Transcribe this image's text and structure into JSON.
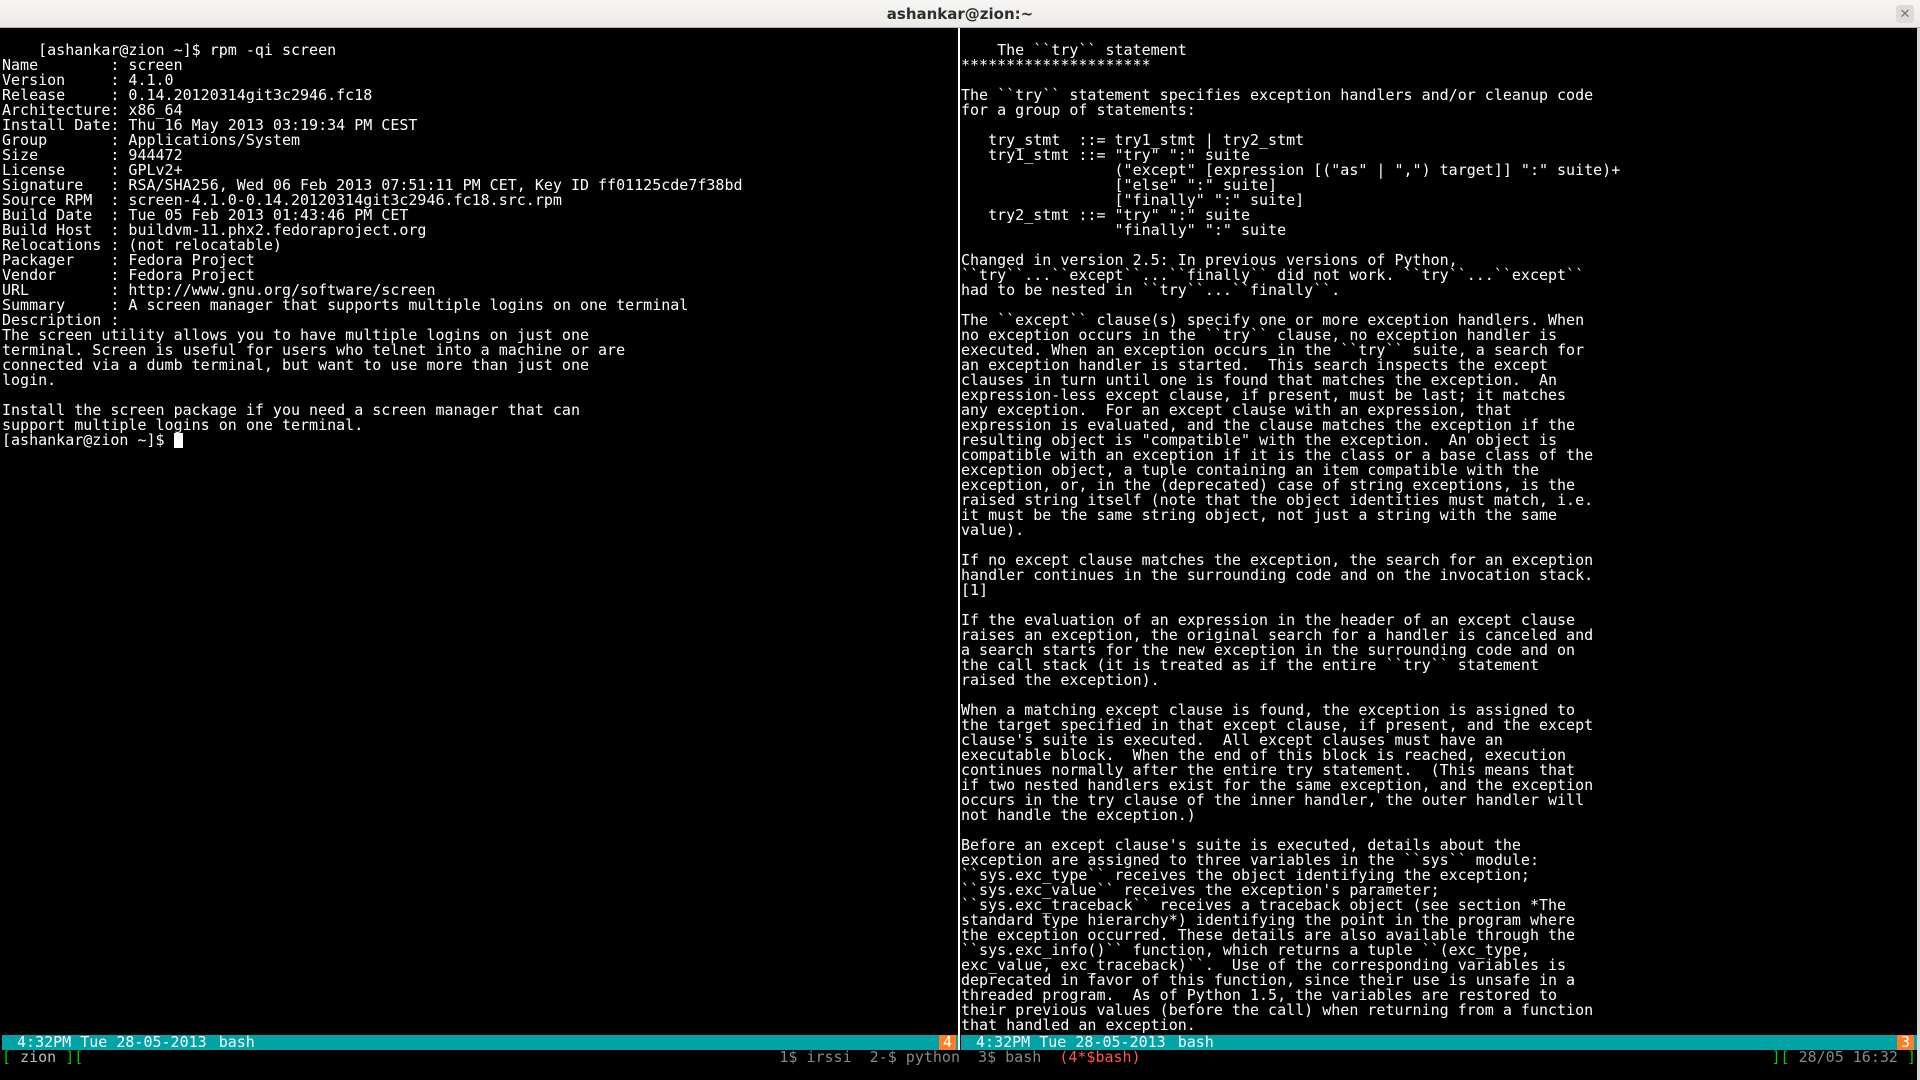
{
  "window": {
    "title": "ashankar@zion:~"
  },
  "left_pane": {
    "text": "[ashankar@zion ~]$ rpm -qi screen\nName        : screen\nVersion     : 4.1.0\nRelease     : 0.14.20120314git3c2946.fc18\nArchitecture: x86_64\nInstall Date: Thu 16 May 2013 03:19:34 PM CEST\nGroup       : Applications/System\nSize        : 944472\nLicense     : GPLv2+\nSignature   : RSA/SHA256, Wed 06 Feb 2013 07:51:11 PM CET, Key ID ff01125cde7f38bd\nSource RPM  : screen-4.1.0-0.14.20120314git3c2946.fc18.src.rpm\nBuild Date  : Tue 05 Feb 2013 01:43:46 PM CET\nBuild Host  : buildvm-11.phx2.fedoraproject.org\nRelocations : (not relocatable)\nPackager    : Fedora Project\nVendor      : Fedora Project\nURL         : http://www.gnu.org/software/screen\nSummary     : A screen manager that supports multiple logins on one terminal\nDescription :\nThe screen utility allows you to have multiple logins on just one\nterminal. Screen is useful for users who telnet into a machine or are\nconnected via a dumb terminal, but want to use more than just one\nlogin.\n\nInstall the screen package if you need a screen manager that can\nsupport multiple logins on one terminal.\n[ashankar@zion ~]$ ",
    "caption_time": " 4:32PM Tue 28-05-2013",
    "caption_label": "bash",
    "caption_badge": "4"
  },
  "right_pane": {
    "text": "The ``try`` statement\n*********************\n\nThe ``try`` statement specifies exception handlers and/or cleanup code\nfor a group of statements:\n\n   try_stmt  ::= try1_stmt | try2_stmt\n   try1_stmt ::= \"try\" \":\" suite\n                 (\"except\" [expression [(\"as\" | \",\") target]] \":\" suite)+\n                 [\"else\" \":\" suite]\n                 [\"finally\" \":\" suite]\n   try2_stmt ::= \"try\" \":\" suite\n                 \"finally\" \":\" suite\n\nChanged in version 2.5: In previous versions of Python,\n``try``...``except``...``finally`` did not work. ``try``...``except``\nhad to be nested in ``try``...``finally``.\n\nThe ``except`` clause(s) specify one or more exception handlers. When\nno exception occurs in the ``try`` clause, no exception handler is\nexecuted. When an exception occurs in the ``try`` suite, a search for\nan exception handler is started.  This search inspects the except\nclauses in turn until one is found that matches the exception.  An\nexpression-less except clause, if present, must be last; it matches\nany exception.  For an except clause with an expression, that\nexpression is evaluated, and the clause matches the exception if the\nresulting object is \"compatible\" with the exception.  An object is\ncompatible with an exception if it is the class or a base class of the\nexception object, a tuple containing an item compatible with the\nexception, or, in the (deprecated) case of string exceptions, is the\nraised string itself (note that the object identities must match, i.e.\nit must be the same string object, not just a string with the same\nvalue).\n\nIf no except clause matches the exception, the search for an exception\nhandler continues in the surrounding code and on the invocation stack.\n[1]\n\nIf the evaluation of an expression in the header of an except clause\nraises an exception, the original search for a handler is canceled and\na search starts for the new exception in the surrounding code and on\nthe call stack (it is treated as if the entire ``try`` statement\nraised the exception).\n\nWhen a matching except clause is found, the exception is assigned to\nthe target specified in that except clause, if present, and the except\nclause's suite is executed.  All except clauses must have an\nexecutable block.  When the end of this block is reached, execution\ncontinues normally after the entire try statement.  (This means that\nif two nested handlers exist for the same exception, and the exception\noccurs in the try clause of the inner handler, the outer handler will\nnot handle the exception.)\n\nBefore an except clause's suite is executed, details about the\nexception are assigned to three variables in the ``sys`` module:\n``sys.exc_type`` receives the object identifying the exception;\n``sys.exc_value`` receives the exception's parameter;\n``sys.exc_traceback`` receives a traceback object (see section *The\nstandard type hierarchy*) identifying the point in the program where\nthe exception occurred. These details are also available through the\n``sys.exc_info()`` function, which returns a tuple ``(exc_type,\nexc_value, exc_traceback)``.  Use of the corresponding variables is\ndeprecated in favor of this function, since their use is unsafe in a\nthreaded program.  As of Python 1.5, the variables are restored to\ntheir previous values (before the call) when returning from a function\nthat handled an exception.\n:",
    "caption_time": " 4:32PM Tue 28-05-2013",
    "caption_label": "bash",
    "caption_badge": "3"
  },
  "hardstatus": {
    "host": "zion",
    "windows_pre": "1$ irssi  2-$ python  3$ bash  ",
    "windows_cur": "(4*$bash)",
    "date": "28/05",
    "time": "16:32"
  }
}
